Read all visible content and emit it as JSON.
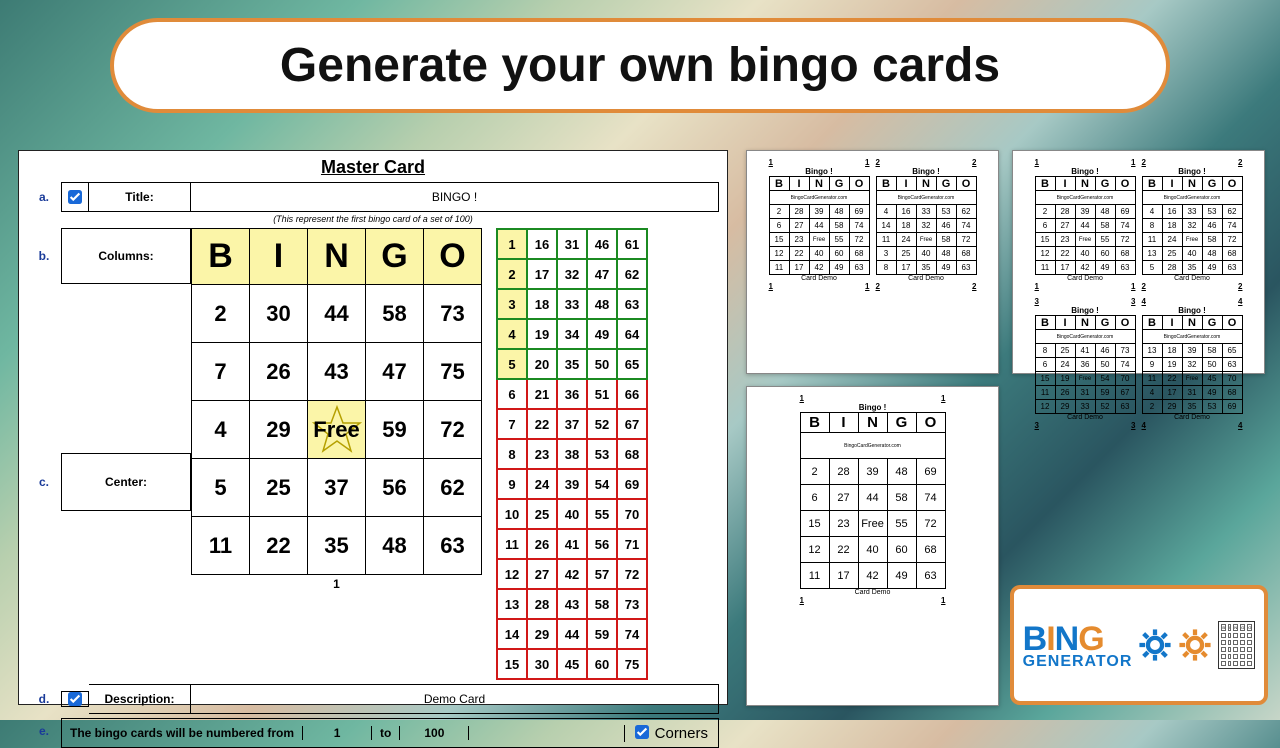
{
  "header": {
    "title": "Generate your own bingo cards"
  },
  "editor": {
    "master_card_heading": "Master Card",
    "labels": {
      "a": "a.",
      "b": "b.",
      "c": "c.",
      "d": "d.",
      "e": "e."
    },
    "title_label": "Title:",
    "title_value": "BINGO !",
    "subtitle": "(This represent the first bingo card of a set of 100)",
    "columns_label": "Columns:",
    "center_label": "Center:",
    "description_label": "Description:",
    "description_value": "Demo Card",
    "number_text_1": "The bingo cards will be numbered from",
    "number_from": "1",
    "number_text_2": "to",
    "number_to": "100",
    "corners_label": "Corners",
    "card_number": "1",
    "headers": [
      "B",
      "I",
      "N",
      "G",
      "O"
    ],
    "card": [
      [
        2,
        30,
        44,
        58,
        73
      ],
      [
        7,
        26,
        43,
        47,
        75
      ],
      [
        4,
        29,
        "Free",
        59,
        72
      ],
      [
        5,
        25,
        37,
        56,
        62
      ],
      [
        11,
        22,
        35,
        48,
        63
      ]
    ],
    "ref_green": [
      [
        1,
        16,
        31,
        46,
        61
      ],
      [
        2,
        17,
        32,
        47,
        62
      ],
      [
        3,
        18,
        33,
        48,
        63
      ],
      [
        4,
        19,
        34,
        49,
        64
      ],
      [
        5,
        20,
        35,
        50,
        65
      ]
    ],
    "ref_red": [
      [
        6,
        21,
        36,
        51,
        66
      ],
      [
        7,
        22,
        37,
        52,
        67
      ],
      [
        8,
        23,
        38,
        53,
        68
      ],
      [
        9,
        24,
        39,
        54,
        69
      ],
      [
        10,
        25,
        40,
        55,
        70
      ],
      [
        11,
        26,
        41,
        56,
        71
      ],
      [
        12,
        27,
        42,
        57,
        72
      ],
      [
        13,
        28,
        43,
        58,
        73
      ],
      [
        14,
        29,
        44,
        59,
        74
      ],
      [
        15,
        30,
        45,
        60,
        75
      ]
    ]
  },
  "previews": {
    "sheet_title": "Bingo !",
    "sheet_sub": "BingoCardGenerator.com",
    "sheet_caption": "Card Demo",
    "p1_card": [
      [
        2,
        28,
        39,
        48,
        69
      ],
      [
        6,
        27,
        44,
        58,
        74
      ],
      [
        15,
        23,
        "Free",
        55,
        72
      ],
      [
        12,
        22,
        40,
        60,
        68
      ],
      [
        11,
        17,
        42,
        49,
        63
      ]
    ],
    "p2_cards": [
      [
        [
          2,
          28,
          39,
          48,
          69
        ],
        [
          6,
          27,
          44,
          58,
          74
        ],
        [
          15,
          23,
          "Free",
          55,
          72
        ],
        [
          12,
          22,
          40,
          60,
          68
        ],
        [
          11,
          17,
          42,
          49,
          63
        ]
      ],
      [
        [
          4,
          16,
          33,
          53,
          62
        ],
        [
          14,
          18,
          32,
          46,
          74
        ],
        [
          11,
          24,
          "Free",
          58,
          72
        ],
        [
          3,
          25,
          40,
          48,
          68
        ],
        [
          8,
          17,
          35,
          49,
          63
        ]
      ]
    ],
    "p4_cards": [
      [
        [
          2,
          28,
          39,
          48,
          69
        ],
        [
          6,
          27,
          44,
          58,
          74
        ],
        [
          15,
          23,
          "Free",
          55,
          72
        ],
        [
          12,
          22,
          40,
          60,
          68
        ],
        [
          11,
          17,
          42,
          49,
          63
        ]
      ],
      [
        [
          4,
          16,
          33,
          53,
          62
        ],
        [
          8,
          18,
          32,
          46,
          74
        ],
        [
          11,
          24,
          "Free",
          58,
          72
        ],
        [
          13,
          25,
          40,
          48,
          68
        ],
        [
          5,
          28,
          35,
          49,
          63
        ]
      ],
      [
        [
          8,
          25,
          41,
          46,
          73
        ],
        [
          6,
          24,
          36,
          50,
          74
        ],
        [
          15,
          19,
          "Free",
          54,
          70
        ],
        [
          11,
          26,
          31,
          59,
          67
        ],
        [
          12,
          29,
          33,
          52,
          63
        ]
      ],
      [
        [
          13,
          18,
          39,
          58,
          65
        ],
        [
          9,
          19,
          32,
          50,
          63
        ],
        [
          11,
          22,
          "Free",
          45,
          70
        ],
        [
          4,
          17,
          31,
          49,
          68
        ],
        [
          2,
          29,
          35,
          53,
          69
        ]
      ]
    ]
  },
  "logo": {
    "t1": "BING",
    "t2": "GENERATOR"
  }
}
